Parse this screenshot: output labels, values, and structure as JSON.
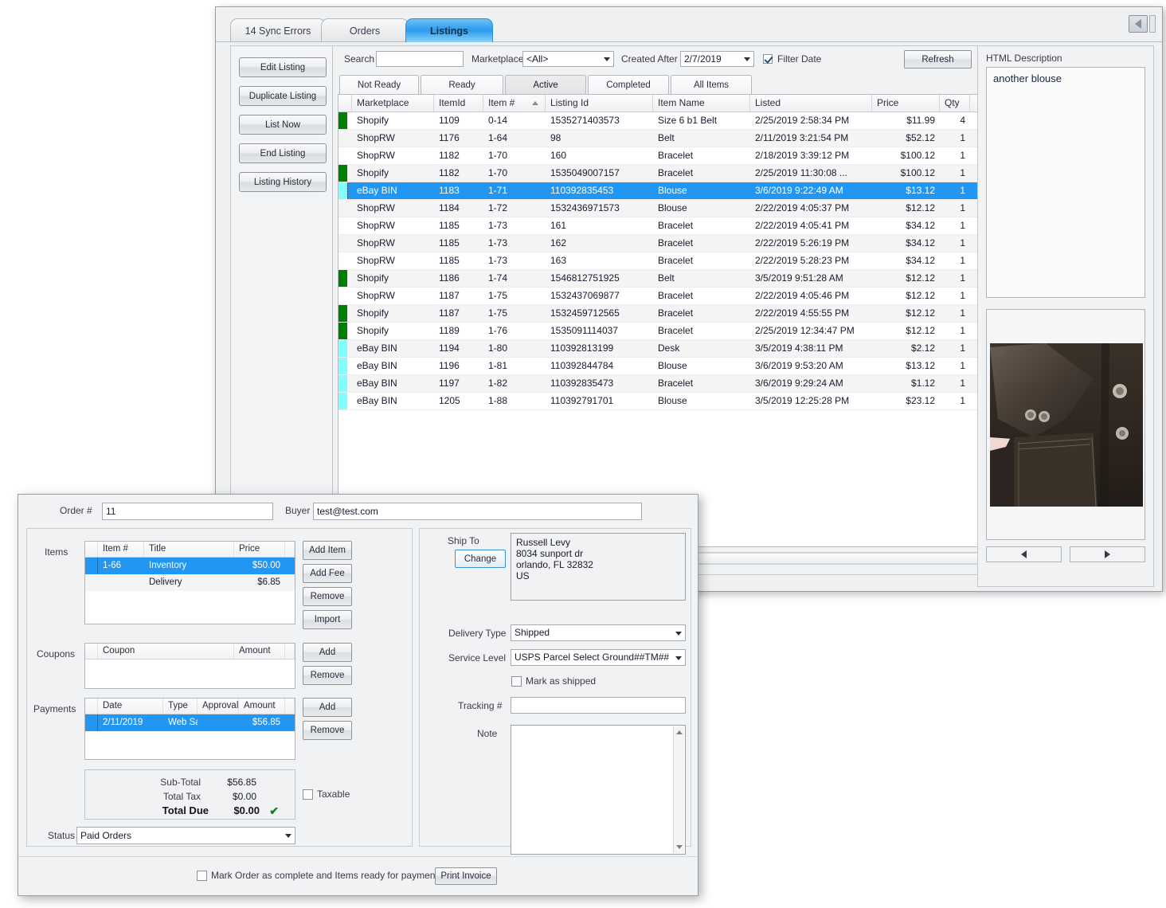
{
  "window": {
    "tabs": [
      {
        "label": "14 Sync Errors",
        "selected": false
      },
      {
        "label": "Orders",
        "selected": false
      },
      {
        "label": "Listings",
        "selected": true
      }
    ],
    "collapse_icon": "triangle-left-icon"
  },
  "sidebar": {
    "buttons": [
      {
        "label": "Edit Listing"
      },
      {
        "label": "Duplicate Listing"
      },
      {
        "label": "List Now"
      },
      {
        "label": "End Listing"
      },
      {
        "label": "Listing History"
      }
    ]
  },
  "filterbar": {
    "search_label": "Search",
    "search_value": "",
    "search_placeholder": "",
    "marketplace_label": "Marketplace",
    "marketplace_value": "<All>",
    "created_after_label": "Created After",
    "created_after_value": "2/7/2019",
    "filter_date_label": "Filter Date",
    "filter_date_checked": true,
    "refresh_label": "Refresh"
  },
  "subtabs": [
    {
      "label": "Not Ready",
      "selected": false
    },
    {
      "label": "Ready",
      "selected": false
    },
    {
      "label": "Active",
      "selected": true
    },
    {
      "label": "Completed",
      "selected": false
    },
    {
      "label": "All Items",
      "selected": false
    }
  ],
  "grid": {
    "columns": [
      "Marketplace",
      "ItemId",
      "Item #",
      "Listing Id",
      "Item Name",
      "Listed",
      "Price",
      "Qty"
    ],
    "sorted_column": "Item #",
    "sort_direction": "asc",
    "rows": [
      {
        "color": "#008000",
        "marketplace": "Shopify",
        "itemid": "1109",
        "itemnum": "0-14",
        "listingid": "1535271403573",
        "itemname": "Size 6 b1 Belt",
        "listed": "2/25/2019 2:58:34 PM",
        "price": "$11.99",
        "qty": "4",
        "selected": false
      },
      {
        "color": "",
        "marketplace": "ShopRW",
        "itemid": "1176",
        "itemnum": "1-64",
        "listingid": "98",
        "itemname": "Belt",
        "listed": "2/11/2019 3:21:54 PM",
        "price": "$52.12",
        "qty": "1",
        "selected": false
      },
      {
        "color": "",
        "marketplace": "ShopRW",
        "itemid": "1182",
        "itemnum": "1-70",
        "listingid": "160",
        "itemname": "Bracelet",
        "listed": "2/18/2019 3:39:12 PM",
        "price": "$100.12",
        "qty": "1",
        "selected": false
      },
      {
        "color": "#008000",
        "marketplace": "Shopify",
        "itemid": "1182",
        "itemnum": "1-70",
        "listingid": "1535049007157",
        "itemname": "Bracelet",
        "listed": "2/25/2019 11:30:08 ...",
        "price": "$100.12",
        "qty": "1",
        "selected": false
      },
      {
        "color": "#7FFFFF",
        "marketplace": "eBay BIN",
        "itemid": "1183",
        "itemnum": "1-71",
        "listingid": "110392835453",
        "itemname": "Blouse",
        "listed": "3/6/2019 9:22:49 AM",
        "price": "$13.12",
        "qty": "1",
        "selected": true
      },
      {
        "color": "",
        "marketplace": "ShopRW",
        "itemid": "1184",
        "itemnum": "1-72",
        "listingid": "1532436971573",
        "itemname": "Blouse",
        "listed": "2/22/2019 4:05:37 PM",
        "price": "$12.12",
        "qty": "1",
        "selected": false
      },
      {
        "color": "",
        "marketplace": "ShopRW",
        "itemid": "1185",
        "itemnum": "1-73",
        "listingid": "161",
        "itemname": "Bracelet",
        "listed": "2/22/2019 4:05:41 PM",
        "price": "$34.12",
        "qty": "1",
        "selected": false
      },
      {
        "color": "",
        "marketplace": "ShopRW",
        "itemid": "1185",
        "itemnum": "1-73",
        "listingid": "162",
        "itemname": "Bracelet",
        "listed": "2/22/2019 5:26:19 PM",
        "price": "$34.12",
        "qty": "1",
        "selected": false
      },
      {
        "color": "",
        "marketplace": "ShopRW",
        "itemid": "1185",
        "itemnum": "1-73",
        "listingid": "163",
        "itemname": "Bracelet",
        "listed": "2/22/2019 5:28:23 PM",
        "price": "$34.12",
        "qty": "1",
        "selected": false
      },
      {
        "color": "#008000",
        "marketplace": "Shopify",
        "itemid": "1186",
        "itemnum": "1-74",
        "listingid": "1546812751925",
        "itemname": "Belt",
        "listed": "3/5/2019 9:51:28 AM",
        "price": "$12.12",
        "qty": "1",
        "selected": false
      },
      {
        "color": "",
        "marketplace": "ShopRW",
        "itemid": "1187",
        "itemnum": "1-75",
        "listingid": "1532437069877",
        "itemname": "Bracelet",
        "listed": "2/22/2019 4:05:46 PM",
        "price": "$12.12",
        "qty": "1",
        "selected": false
      },
      {
        "color": "#008000",
        "marketplace": "Shopify",
        "itemid": "1187",
        "itemnum": "1-75",
        "listingid": "1532459712565",
        "itemname": "Bracelet",
        "listed": "2/22/2019 4:55:55 PM",
        "price": "$12.12",
        "qty": "1",
        "selected": false
      },
      {
        "color": "#008000",
        "marketplace": "Shopify",
        "itemid": "1189",
        "itemnum": "1-76",
        "listingid": "1535091114037",
        "itemname": "Bracelet",
        "listed": "2/25/2019 12:34:47 PM",
        "price": "$12.12",
        "qty": "1",
        "selected": false
      },
      {
        "color": "#7FFFFF",
        "marketplace": "eBay BIN",
        "itemid": "1194",
        "itemnum": "1-80",
        "listingid": "110392813199",
        "itemname": "Desk",
        "listed": "3/5/2019 4:38:11 PM",
        "price": "$2.12",
        "qty": "1",
        "selected": false
      },
      {
        "color": "#7FFFFF",
        "marketplace": "eBay BIN",
        "itemid": "1196",
        "itemnum": "1-81",
        "listingid": "110392844784",
        "itemname": "Blouse",
        "listed": "3/6/2019 9:53:20 AM",
        "price": "$13.12",
        "qty": "1",
        "selected": false
      },
      {
        "color": "#7FFFFF",
        "marketplace": "eBay BIN",
        "itemid": "1197",
        "itemnum": "1-82",
        "listingid": "110392835473",
        "itemname": "Bracelet",
        "listed": "3/6/2019 9:29:24 AM",
        "price": "$1.12",
        "qty": "1",
        "selected": false
      },
      {
        "color": "#7FFFFF",
        "marketplace": "eBay BIN",
        "itemid": "1205",
        "itemnum": "1-88",
        "listingid": "110392791701",
        "itemname": "Blouse",
        "listed": "3/5/2019 12:25:28 PM",
        "price": "$23.12",
        "qty": "1",
        "selected": false
      }
    ]
  },
  "description_panel": {
    "label": "HTML Description",
    "text": "another blouse",
    "prev_icon": "triangle-left-icon",
    "next_icon": "triangle-right-icon",
    "image_alt": "brown velvet jacket sleeve and pocket"
  },
  "order_dialog": {
    "order_num_label": "Order #",
    "order_num_value": "11",
    "buyer_label": "Buyer",
    "buyer_value": "test@test.com",
    "items": {
      "label": "Items",
      "columns": [
        "Item #",
        "Title",
        "Price"
      ],
      "rows": [
        {
          "itemnum": "1-66",
          "title": "Inventory",
          "price": "$50.00",
          "selected": true
        },
        {
          "itemnum": "",
          "title": "Delivery",
          "price": "$6.85",
          "selected": false
        }
      ],
      "buttons": [
        "Add Item",
        "Add Fee",
        "Remove",
        "Import"
      ]
    },
    "coupons": {
      "label": "Coupons",
      "columns": [
        "Coupon",
        "Amount"
      ],
      "rows": [],
      "buttons": [
        "Add",
        "Remove"
      ]
    },
    "payments": {
      "label": "Payments",
      "columns": [
        "Date",
        "Type",
        "Approval",
        "Amount"
      ],
      "rows": [
        {
          "date": "2/11/2019",
          "type": "Web Sale",
          "approval": "",
          "amount": "$56.85",
          "selected": true
        }
      ],
      "buttons": [
        "Add",
        "Remove"
      ]
    },
    "totals": {
      "subtotal_label": "Sub-Total",
      "subtotal_value": "$56.85",
      "tax_label": "Total Tax",
      "tax_value": "$0.00",
      "due_label": "Total Due",
      "due_value": "$0.00",
      "due_icon": "check-icon",
      "taxable_label": "Taxable",
      "taxable_checked": false
    },
    "status_label": "Status",
    "status_value": "Paid Orders",
    "shipping": {
      "ship_to_label": "Ship To",
      "change_label": "Change",
      "address": "Russell Levy\n8034 sunport dr\norlando, FL  32832\nUS",
      "delivery_type_label": "Delivery Type",
      "delivery_type_value": "Shipped",
      "service_level_label": "Service Level",
      "service_level_value": "USPS Parcel Select Ground##TM##",
      "mark_shipped_label": "Mark as shipped",
      "mark_shipped_checked": false,
      "tracking_label": "Tracking #",
      "tracking_value": "",
      "note_label": "Note",
      "note_value": ""
    },
    "footer": {
      "mark_complete_label": "Mark Order as complete and Items ready for payment.",
      "mark_complete_checked": false,
      "print_invoice_label": "Print Invoice"
    }
  },
  "colors": {
    "selection": "#2196f3",
    "shopify_status": "#008000",
    "ebay_status": "#7FFFFF",
    "accent_tab": "#2a9bee",
    "check_green": "#157f22"
  }
}
